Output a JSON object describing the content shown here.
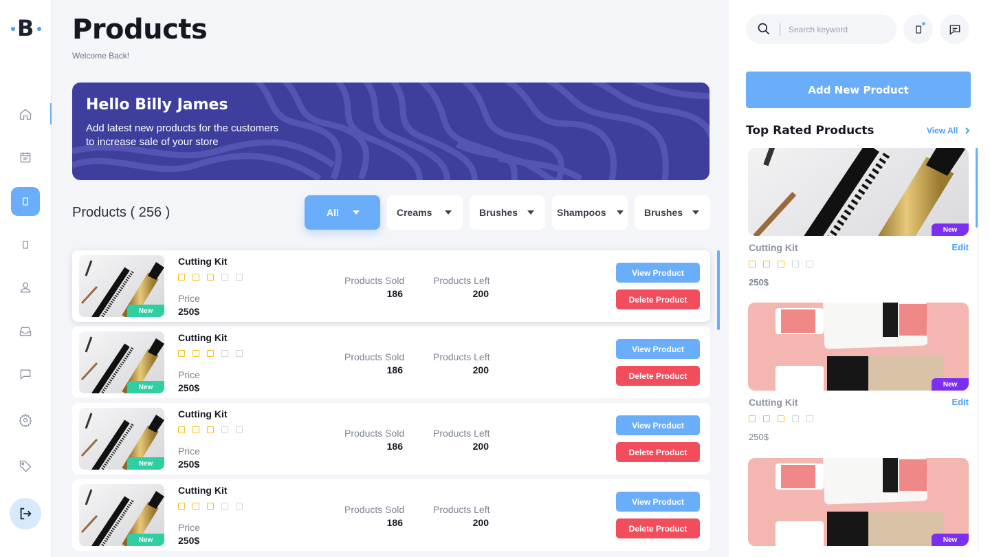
{
  "brand": {
    "logo_letter": "B"
  },
  "sidebar": {
    "items": [
      {
        "name": "home",
        "icon": "home-icon"
      },
      {
        "name": "calendar",
        "icon": "calendar-icon"
      },
      {
        "name": "products",
        "icon": "product-icon",
        "active": true
      },
      {
        "name": "device",
        "icon": "device-icon"
      },
      {
        "name": "user",
        "icon": "user-icon"
      },
      {
        "name": "inbox",
        "icon": "inbox-icon"
      },
      {
        "name": "chat",
        "icon": "chat-icon"
      },
      {
        "name": "settings",
        "icon": "gear-icon"
      },
      {
        "name": "tags",
        "icon": "tag-icon"
      }
    ],
    "logout_icon": "logout-icon"
  },
  "header": {
    "title": "Products",
    "subtitle": "Welcome Back!"
  },
  "banner": {
    "title": "Hello Billy James",
    "line1": "Add latest new products for the customers",
    "line2": "to increase sale of your store"
  },
  "products": {
    "count_label": "Products ( 256 )",
    "filters": [
      {
        "label": "All",
        "active": true
      },
      {
        "label": "Creams"
      },
      {
        "label": "Brushes"
      },
      {
        "label": "Shampoos"
      },
      {
        "label": "Brushes"
      }
    ],
    "sold_label": "Products Sold",
    "left_label": "Products Left",
    "price_label": "Price",
    "view_label": "View Product",
    "delete_label": "Delete Product",
    "badge": "New",
    "rows": [
      {
        "name": "Cutting Kit",
        "rating": 3,
        "price": "250$",
        "sold": "186",
        "left": "200"
      },
      {
        "name": "Cutting Kit",
        "rating": 3,
        "price": "250$",
        "sold": "186",
        "left": "200"
      },
      {
        "name": "Cutting Kit",
        "rating": 3,
        "price": "250$",
        "sold": "186",
        "left": "200"
      },
      {
        "name": "Cutting Kit",
        "rating": 3,
        "price": "250$",
        "sold": "186",
        "left": "200"
      }
    ]
  },
  "right_panel": {
    "search_placeholder": "Search keyword",
    "add_button": "Add New Product",
    "top_rated_title": "Top Rated Products",
    "view_all": "View All",
    "cards": [
      {
        "name": "Cutting Kit",
        "edit": "Edit",
        "rating": 3,
        "price": "250$",
        "badge": "New",
        "image": "cutting-kit"
      },
      {
        "name": "Cutting Kit",
        "edit": "Edit",
        "rating": 3,
        "price": "250$",
        "badge": "New",
        "image": "cosmetics"
      },
      {
        "name": "",
        "edit": "",
        "rating": 0,
        "price": "",
        "badge": "New",
        "image": "cosmetics"
      }
    ]
  },
  "colors": {
    "accent": "#6aaefb",
    "danger": "#f24d5d",
    "banner": "#3e3f9d",
    "new_badge": "#2fcfa2",
    "new_badge_alt": "#7b2ff2",
    "star": "#f3c21b"
  }
}
